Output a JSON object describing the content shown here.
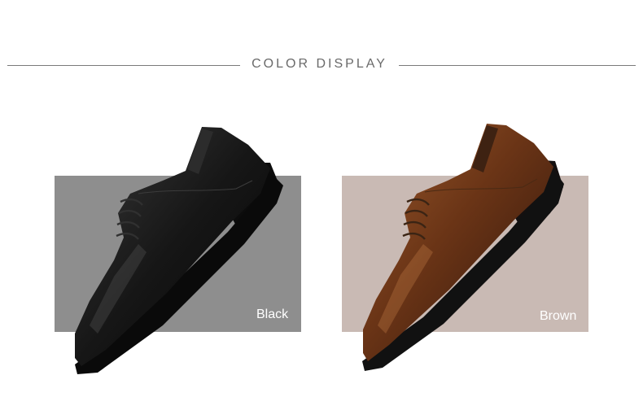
{
  "header": {
    "title": "COLOR DISPLAY"
  },
  "variants": [
    {
      "label": "Black",
      "panel_color": "#8e8e8e",
      "leather_color": "#161616"
    },
    {
      "label": "Brown",
      "panel_color": "#c9bab4",
      "leather_color": "#6a3416"
    }
  ]
}
